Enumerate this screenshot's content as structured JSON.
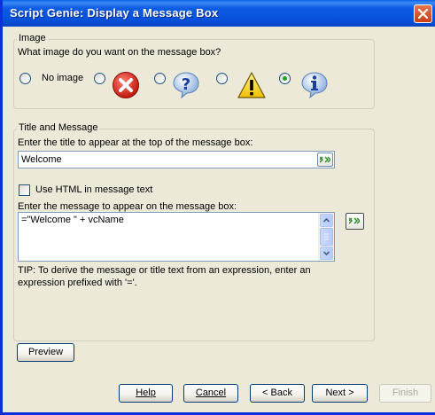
{
  "window": {
    "title": "Script Genie:  Display a Message Box"
  },
  "image_group": {
    "title": "Image",
    "prompt": "What image do you want on the message box?",
    "options": [
      {
        "label": "No image",
        "icon": "none",
        "checked": false
      },
      {
        "label": "",
        "icon": "error-icon",
        "checked": false
      },
      {
        "label": "",
        "icon": "question-icon",
        "checked": false
      },
      {
        "label": "",
        "icon": "warning-icon",
        "checked": false
      },
      {
        "label": "",
        "icon": "information-icon",
        "checked": true
      }
    ]
  },
  "message_group": {
    "title": "Title and Message",
    "title_prompt": "Enter the title to appear at the top of the message box:",
    "title_value": "Welcome",
    "html_checkbox_label": "Use HTML in message text",
    "html_checked": false,
    "message_prompt": "Enter the message to appear on the message box:",
    "message_value": "=\"Welcome \" + vcName",
    "tip": "TIP: To derive the message or title text from an expression, enter an expression prefixed with '='."
  },
  "buttons": {
    "preview": "Preview",
    "help": "Help",
    "cancel": "Cancel",
    "back": "< Back",
    "next": "Next >",
    "finish": "Finish"
  },
  "colors": {
    "titlebar": "#0653dc",
    "dialog_bg": "#ece9d8",
    "close_button": "#c93e14",
    "radio_selected": "#21a121"
  }
}
